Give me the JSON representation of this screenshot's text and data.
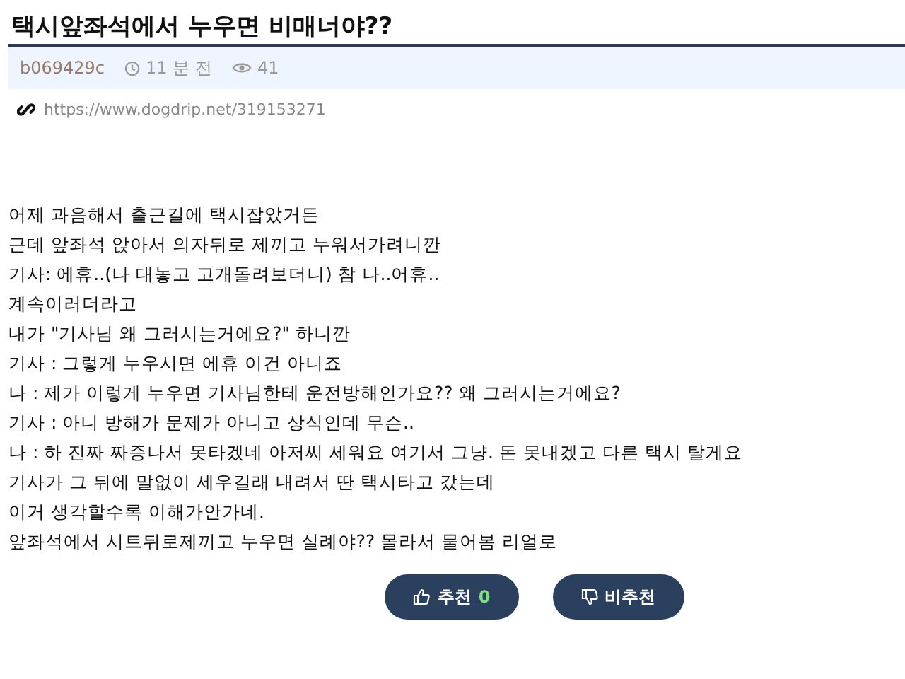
{
  "title": "택시앞좌석에서 누우면 비매너야??",
  "meta": {
    "author": "b069429c",
    "time": "11 분 전",
    "views": "41"
  },
  "url": "https://www.dogdrip.net/319153271",
  "body": [
    "어제 과음해서 출근길에 택시잡았거든",
    "근데 앞좌석 앉아서 의자뒤로 제끼고 누워서가려니깐",
    "기사: 에휴..(나 대놓고 고개돌려보더니) 참 나..어휴..",
    "계속이러더라고",
    "내가 \"기사님 왜 그러시는거에요?\" 하니깐",
    "기사 : 그렇게 누우시면 에휴 이건 아니죠",
    "나 : 제가 이렇게 누우면 기사님한테 운전방해인가요?? 왜 그러시는거에요?",
    "기사 : 아니 방해가 문제가 아니고 상식인데 무슨..",
    "나 : 하 진짜 짜증나서 못타겠네 아저씨 세워요 여기서 그냥. 돈 못내겠고 다른 택시 탈게요",
    "기사가 그 뒤에 말없이 세우길래 내려서 딴 택시타고 갔는데",
    "이거 생각할수록 이해가안가네.",
    "앞좌석에서 시트뒤로제끼고 누우면 실례야?? 몰라서 물어봄 리얼로"
  ],
  "vote": {
    "up_label": "추천",
    "up_count": "0",
    "down_label": "비추천"
  }
}
